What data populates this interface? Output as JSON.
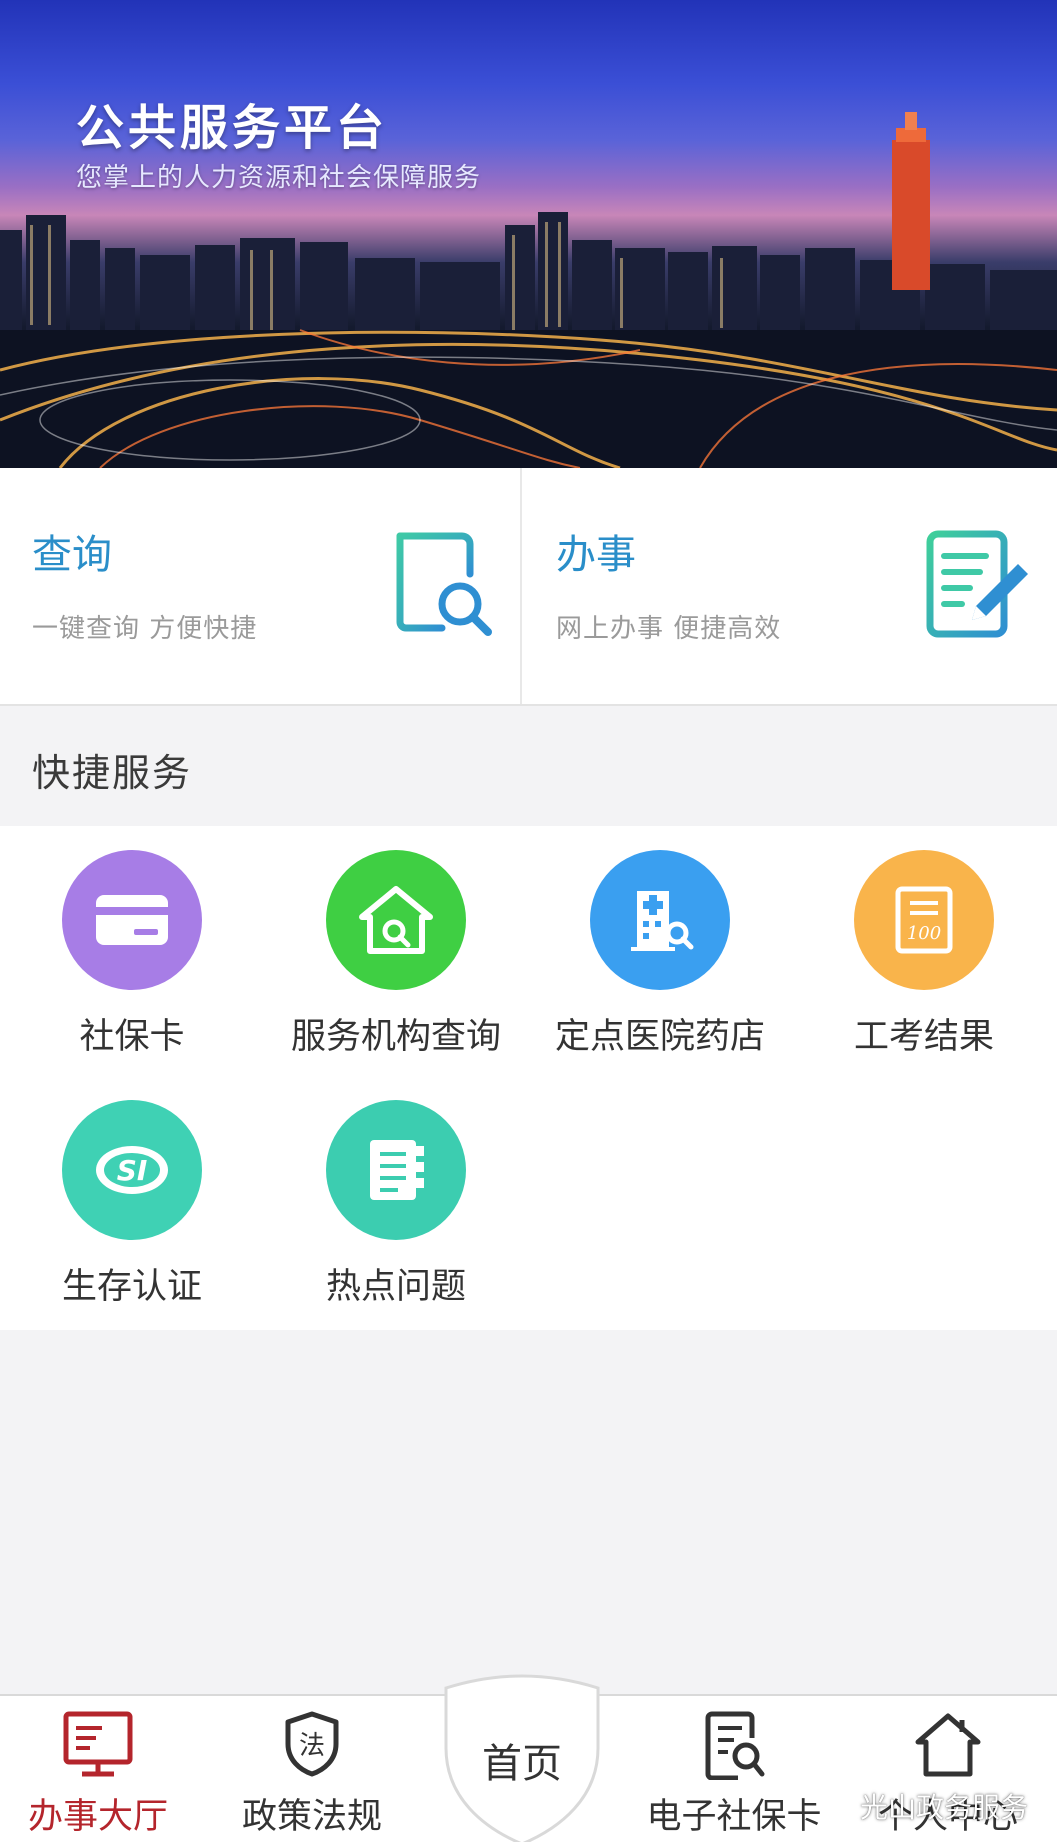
{
  "banner": {
    "title": "公共服务平台",
    "subtitle": "您掌上的人力资源和社会保障服务"
  },
  "actions": [
    {
      "title": "查询",
      "desc": "一键查询 方便快捷",
      "icon": "document-search-icon"
    },
    {
      "title": "办事",
      "desc": "网上办事 便捷高效",
      "icon": "document-edit-icon"
    }
  ],
  "quick_services": {
    "title": "快捷服务",
    "items": [
      {
        "label": "社保卡",
        "icon": "card-icon",
        "color": "#a77de6"
      },
      {
        "label": "服务机构查询",
        "icon": "home-search-icon",
        "color": "#3fcf43"
      },
      {
        "label": "定点医院药店",
        "icon": "hospital-search-icon",
        "color": "#3a9ff0"
      },
      {
        "label": "工考结果",
        "icon": "exam-score-icon",
        "color": "#f9b44b"
      },
      {
        "label": "生存认证",
        "icon": "si-logo-icon",
        "color": "#3fd1b4"
      },
      {
        "label": "热点问题",
        "icon": "notebook-icon",
        "color": "#3ccdb0"
      }
    ]
  },
  "bottom_nav": {
    "items": [
      {
        "label": "办事大厅",
        "icon": "monitor-icon",
        "active": true
      },
      {
        "label": "政策法规",
        "icon": "law-shield-icon",
        "active": false
      },
      {
        "label": "首页",
        "icon": "home-shield",
        "active": false
      },
      {
        "label": "电子社保卡",
        "icon": "document-search-icon",
        "active": false
      },
      {
        "label": "个人中心",
        "icon": "house-icon",
        "active": false
      }
    ]
  },
  "watermark": {
    "text": "光山政务服务"
  },
  "colors": {
    "accent": "#2a8ec9",
    "active_nav": "#b4252c"
  }
}
